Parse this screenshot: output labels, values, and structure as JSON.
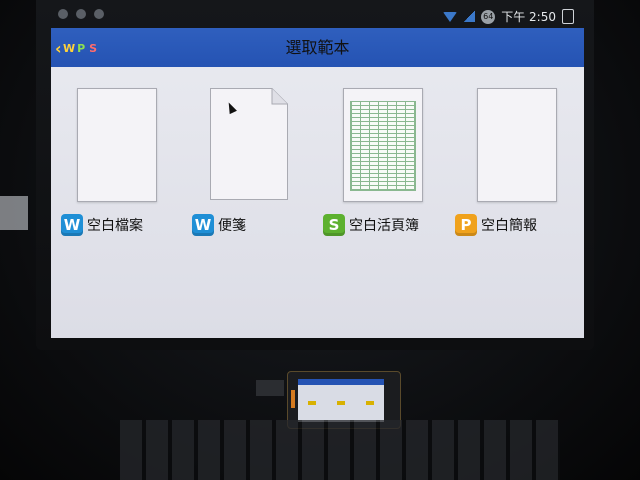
{
  "status_bar": {
    "battery_level": "64",
    "time": "下午 2:50"
  },
  "header": {
    "back_logo": "WPS",
    "title": "選取範本"
  },
  "templates": [
    {
      "label": "空白檔案",
      "badge": "W",
      "badge_color": "#1f8fd6",
      "type": "document"
    },
    {
      "label": "便箋",
      "badge": "W",
      "badge_color": "#1f8fd6",
      "type": "note"
    },
    {
      "label": "空白活頁簿",
      "badge": "S",
      "badge_color": "#5db12f",
      "type": "spreadsheet"
    },
    {
      "label": "空白簡報",
      "badge": "P",
      "badge_color": "#f0a21c",
      "type": "presentation"
    }
  ],
  "colors": {
    "title_bar": "#2553b3",
    "accent": "#ffd23a"
  }
}
